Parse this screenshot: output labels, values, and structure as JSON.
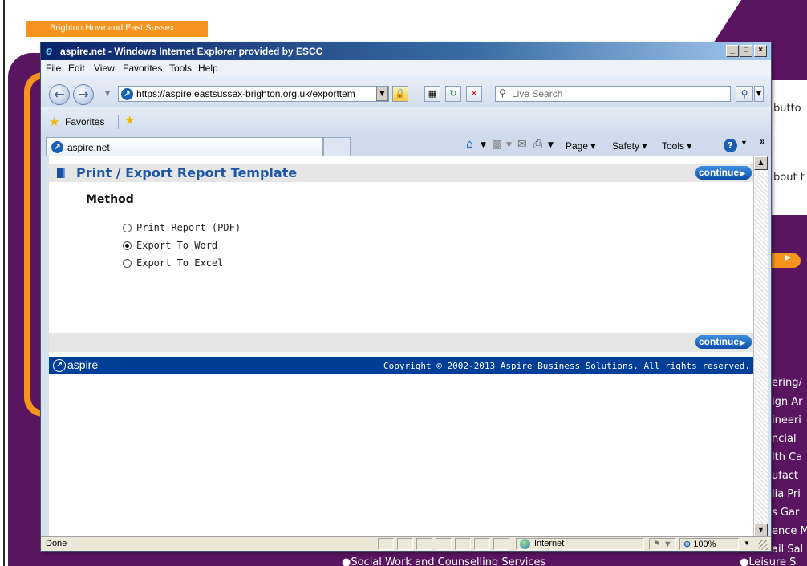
{
  "background_page": {
    "header_tab": "Brighton Hove and East Sussex",
    "right_fragments": [
      "butto",
      "bout t"
    ],
    "right_list": [
      "ering/",
      "ign Ar",
      "ineeri",
      "ncial",
      "lth Ca",
      "ufact",
      "lia Pri",
      "s Gar",
      "ence M",
      "ail Sal"
    ],
    "bottom_items": [
      "Social Work and Counselling Services",
      "Leisure S"
    ]
  },
  "window": {
    "title": "aspire.net - Windows Internet Explorer provided by ESCC",
    "controls": {
      "minimize": "_",
      "maximize": "□",
      "close": "×"
    }
  },
  "menu": [
    "File",
    "Edit",
    "View",
    "Favorites",
    "Tools",
    "Help"
  ],
  "address_bar": {
    "url": "https://aspire.eastsussex-brighton.org.uk/exporttem",
    "search_placeholder": "Live Search"
  },
  "favorites_bar": {
    "label": "Favorites"
  },
  "tab": {
    "label": "aspire.net"
  },
  "command_bar": {
    "page": "Page ▾",
    "safety": "Safety ▾",
    "tools": "Tools ▾",
    "help": "?",
    "more": "»"
  },
  "page": {
    "title": "Print / Export Report Template",
    "continue_label": "continue",
    "method_heading": "Method",
    "options": [
      {
        "label": "Print Report (PDF)",
        "checked": false
      },
      {
        "label": "Export To Word",
        "checked": true
      },
      {
        "label": "Export To Excel",
        "checked": false
      }
    ],
    "footer_logo": "aspire",
    "copyright": "Copyright © 2002-2013 Aspire Business Solutions. All rights reserved."
  },
  "status_bar": {
    "status": "Done",
    "zone": "Internet",
    "zoom": "100%"
  },
  "colors": {
    "background_purple": "#5a1560",
    "background_orange": "#f7941d",
    "title_blue": "#1e56a6",
    "footer_blue": "#003f97"
  }
}
